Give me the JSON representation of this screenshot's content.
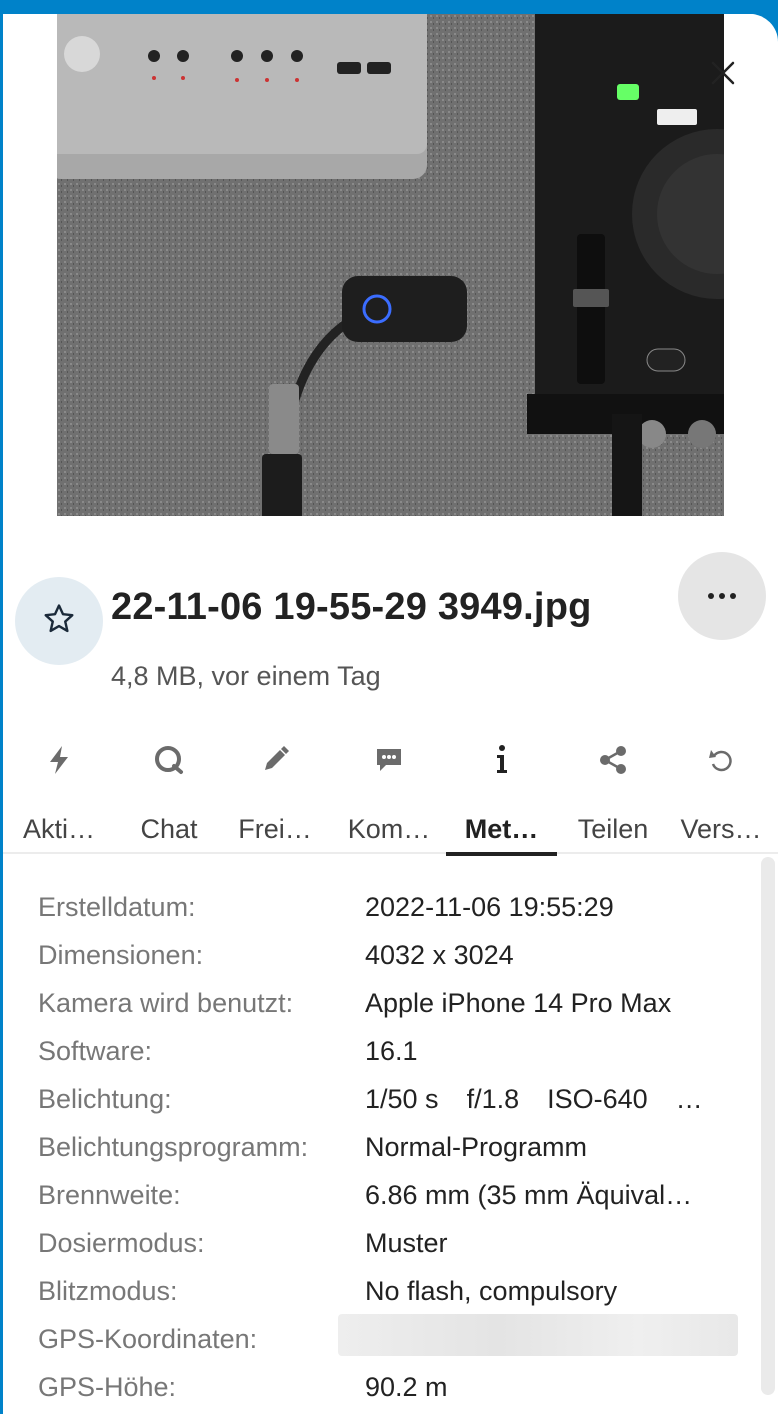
{
  "file": {
    "name": "22-11-06 19-55-29 3949.jpg",
    "subtitle": "4,8 MB, vor einem Tag"
  },
  "icons": {
    "close": "close-icon",
    "favorite": "star-icon",
    "more": "more-icon"
  },
  "tabs": [
    {
      "label": "Akti…",
      "icon": "lightning-icon"
    },
    {
      "label": "Chat",
      "icon": "chat-icon"
    },
    {
      "label": "Frei…",
      "icon": "pencil-icon"
    },
    {
      "label": "Kom…",
      "icon": "comment-icon"
    },
    {
      "label": "Met…",
      "icon": "info-icon",
      "active": true
    },
    {
      "label": "Teilen",
      "icon": "share-icon"
    },
    {
      "label": "Vers…",
      "icon": "restore-icon"
    }
  ],
  "metadata": {
    "created_label": "Erstelldatum:",
    "created_value": "2022-11-06 19:55:29",
    "dimensions_label": "Dimensionen:",
    "dimensions_value": "4032 x 3024",
    "camera_label": "Kamera wird benutzt:",
    "camera_value": "Apple iPhone 14 Pro Max",
    "software_label": "Software:",
    "software_value": "16.1",
    "exposure_label": "Belichtung:",
    "exposure_shutter": "1/50 s",
    "exposure_aperture": "f/1.8",
    "exposure_iso": "ISO-640",
    "exposure_more": "…",
    "program_label": "Belichtungsprogramm:",
    "program_value": "Normal-Programm",
    "focal_label": "Brennweite:",
    "focal_value": "6.86 mm (35 mm Äquival…",
    "metering_label": "Dosiermodus:",
    "metering_value": "Muster",
    "flash_label": "Blitzmodus:",
    "flash_value": "No flash, compulsory",
    "gps_label": "GPS-Koordinaten:",
    "altitude_label": "GPS-Höhe:",
    "altitude_value": "90.2 m"
  },
  "colors": {
    "brand": "#0082c9",
    "fav_bg": "#e3ecf2",
    "more_bg": "#e5e5e5"
  }
}
